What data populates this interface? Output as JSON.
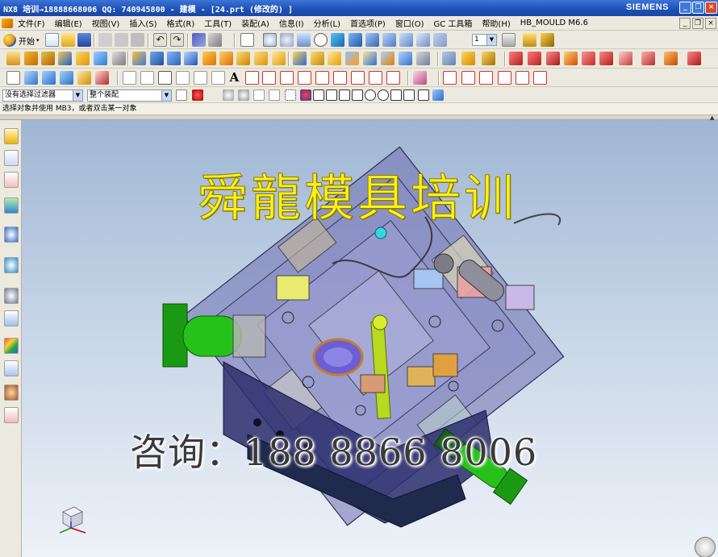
{
  "title_bar": {
    "title": "NX8 培训→18888668006 QQ: 740945800 - 建模 - [24.prt  (修改的) ]",
    "brand": "SIEMENS",
    "buttons": {
      "minimize": "_",
      "restore": "❐",
      "close": "×"
    }
  },
  "menu": {
    "items": [
      "文件(F)",
      "编辑(E)",
      "视图(V)",
      "插入(S)",
      "格式(R)",
      "工具(T)",
      "装配(A)",
      "信息(I)",
      "分析(L)",
      "首选项(P)",
      "窗口(O)",
      "GC 工具箱",
      "帮助(H)",
      "HB_MOULD M6.6"
    ]
  },
  "toolbar": {
    "start_label": "开始",
    "layer_value": "1",
    "filter_value": "没有选择过滤器",
    "assembly_scope_value": "整个装配"
  },
  "cue_line": "选择对象并使用 MB3，或者双击某一对象",
  "watermark": {
    "top": "舜龍模具培训",
    "bottom": "咨询：188  8866  8006"
  },
  "colors": {
    "titlebar": "#1d4fb4",
    "toolbar_bg": "#eceade",
    "viewport_top": "#9fb6d3",
    "viewport_bottom": "#eef2f8",
    "mold_body": "#4b4f93",
    "cylinder_green": "#22b51b",
    "watermark_yellow": "#fff01a"
  },
  "icons": {
    "nav": [
      "part-navigator-icon",
      "assembly-navigator-icon",
      "constraint-navigator-icon",
      "reuse-library-icon",
      "web-browser-icon",
      "history-icon",
      "clock-icon",
      "process-studio-icon",
      "color-palette-icon",
      "system-materials-icon",
      "roles-icon",
      "drafting-icon"
    ]
  }
}
